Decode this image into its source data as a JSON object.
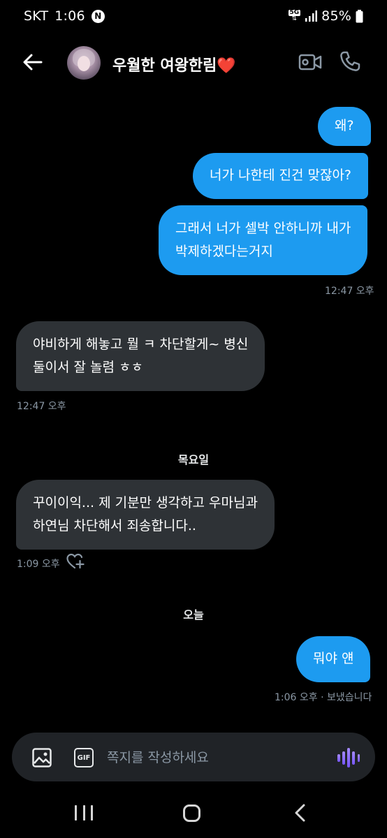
{
  "status_bar": {
    "carrier": "SKT",
    "time": "1:06",
    "notification_letter": "N",
    "network": "5G",
    "network_arrows": "⇅",
    "battery": "85%"
  },
  "header": {
    "contact_name": "우월한 여왕한림",
    "heart": "❤️"
  },
  "messages": [
    {
      "direction": "outgoing",
      "lines": [
        "왜?"
      ]
    },
    {
      "direction": "outgoing",
      "lines": [
        "너가 나한테 진건 맞잖아?"
      ]
    },
    {
      "direction": "outgoing",
      "lines": [
        "그래서 너가 셀박 안하니까 내가",
        "박제하겠다는거지"
      ]
    },
    {
      "direction": "incoming",
      "lines": [
        "야비하게 해놓고 뭘 ㅋ 차단할게~ 병신",
        "둘이서 잘 놀렴 ㅎㅎ"
      ]
    },
    {
      "direction": "incoming",
      "lines": [
        "꾸이이익... 제 기분만 생각하고 우마님과",
        "하연님 차단해서 죄송합니다.."
      ]
    },
    {
      "direction": "outgoing",
      "lines": [
        "뭐야 얜"
      ]
    }
  ],
  "timestamps": {
    "t1": "12:47 오후",
    "t2": "12:47 오후",
    "t3": "1:09 오후",
    "t4": "1:06 오후 · 보냈습니다"
  },
  "day_separators": {
    "thursday": "목요일",
    "today": "오늘"
  },
  "composer": {
    "placeholder": "쪽지를 작성하세요",
    "gif_label": "GIF"
  },
  "colors": {
    "background": "#000000",
    "outgoing_bubble": "#1d9bf0",
    "incoming_bubble": "#2e3236",
    "accent_voice": "#7856ff"
  },
  "icons": [
    "back-arrow-icon",
    "video-call-icon",
    "phone-icon",
    "add-reaction-icon",
    "image-icon",
    "gif-icon",
    "voice-message-icon",
    "recent-apps-icon",
    "home-icon",
    "nav-back-icon"
  ]
}
